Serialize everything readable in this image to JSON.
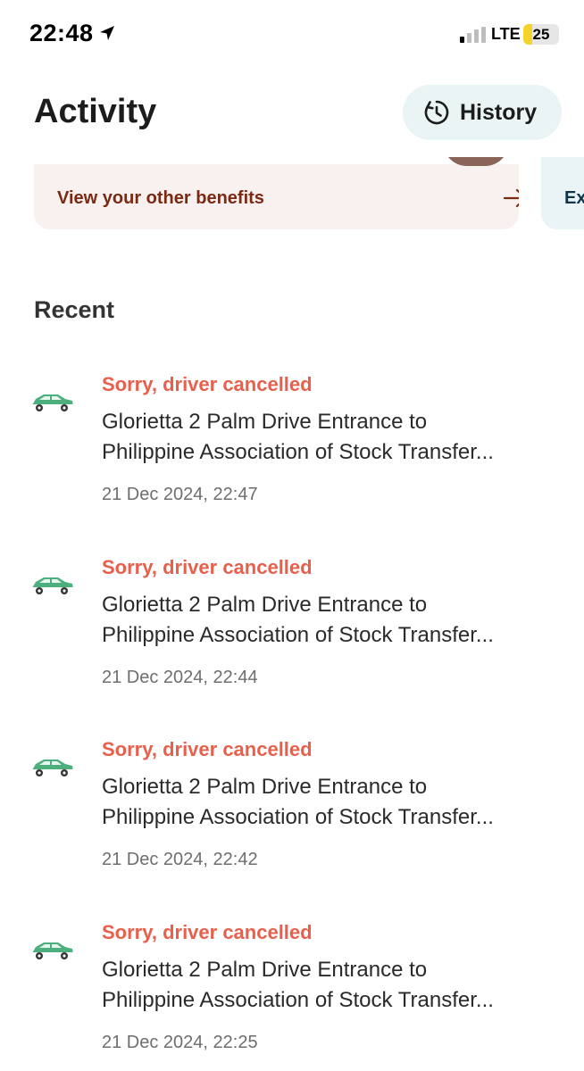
{
  "status_bar": {
    "time": "22:48",
    "network": "LTE",
    "battery_level": "25",
    "battery_fraction": 0.25,
    "battery_color": "#f5d32a"
  },
  "header": {
    "title": "Activity",
    "history_label": "History"
  },
  "benefits": {
    "label": "View your other benefits",
    "next_card_label": "Ex"
  },
  "recent": {
    "title": "Recent",
    "items": [
      {
        "status": "Sorry, driver cancelled",
        "route_line1": "Glorietta 2 Palm Drive Entrance to",
        "route_line2": "Philippine Association of Stock Transfer...",
        "date": "21 Dec 2024, 22:47"
      },
      {
        "status": "Sorry, driver cancelled",
        "route_line1": "Glorietta 2 Palm Drive Entrance to",
        "route_line2": "Philippine Association of Stock Transfer...",
        "date": "21 Dec 2024, 22:44"
      },
      {
        "status": "Sorry, driver cancelled",
        "route_line1": "Glorietta 2 Palm Drive Entrance to",
        "route_line2": "Philippine Association of Stock Transfer...",
        "date": "21 Dec 2024, 22:42"
      },
      {
        "status": "Sorry, driver cancelled",
        "route_line1": "Glorietta 2 Palm Drive Entrance to",
        "route_line2": "Philippine Association of Stock Transfer...",
        "date": "21 Dec 2024, 22:25"
      }
    ]
  },
  "colors": {
    "status_cancelled": "#e8604c",
    "benefits_text": "#7a2a13",
    "history_button_bg": "#eaf4f5",
    "car_green": "#4caf7d"
  },
  "icons": {
    "location": "location-arrow-icon",
    "signal": "signal-icon",
    "history": "history-clock-icon",
    "arrow": "arrow-right-icon",
    "car": "car-icon"
  }
}
